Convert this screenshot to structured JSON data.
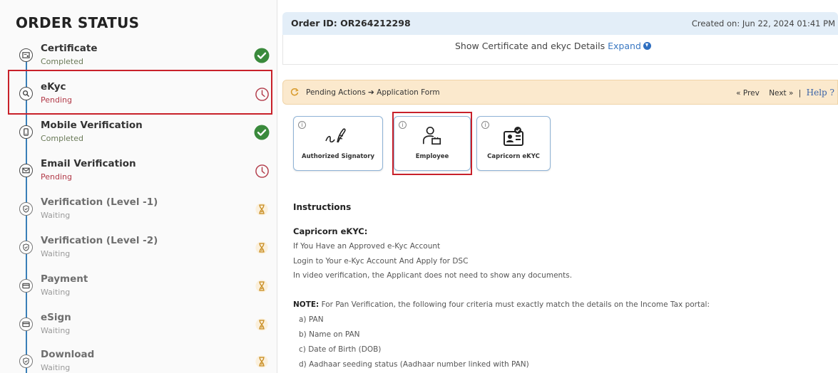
{
  "sidebar": {
    "title": "ORDER STATUS",
    "steps": [
      {
        "label": "Certificate",
        "status": "Completed",
        "state": "completed",
        "icon": "certificate-icon"
      },
      {
        "label": "eKyc",
        "status": "Pending",
        "state": "pending",
        "icon": "search-icon"
      },
      {
        "label": "Mobile Verification",
        "status": "Completed",
        "state": "completed",
        "icon": "mobile-icon"
      },
      {
        "label": "Email Verification",
        "status": "Pending",
        "state": "pending",
        "icon": "envelope-icon"
      },
      {
        "label": "Verification (Level -1)",
        "status": "Waiting",
        "state": "waiting",
        "icon": "shield-icon"
      },
      {
        "label": "Verification (Level -2)",
        "status": "Waiting",
        "state": "waiting",
        "icon": "shield-icon"
      },
      {
        "label": "Payment",
        "status": "Waiting",
        "state": "waiting",
        "icon": "card-icon"
      },
      {
        "label": "eSign",
        "status": "Waiting",
        "state": "waiting",
        "icon": "card-icon"
      },
      {
        "label": "Download",
        "status": "Waiting",
        "state": "waiting",
        "icon": "shield-icon"
      }
    ]
  },
  "header": {
    "order_id": "Order ID: OR264212298",
    "created_on": "Created on: Jun 22, 2024 01:41 PM"
  },
  "certificate_details": {
    "text": "Show Certificate and ekyc Details",
    "expand_label": "Expand"
  },
  "pending_bar": {
    "breadcrumb": "Pending Actions ➔ Application Form",
    "prev_label": "« Prev",
    "next_label": "Next »",
    "help_label": "Help ?"
  },
  "cards": [
    {
      "label": "Authorized Signatory",
      "icon": "signature-icon"
    },
    {
      "label": "Employee",
      "icon": "employee-icon"
    },
    {
      "label": "Capricorn eKYC",
      "icon": "id-card-icon"
    }
  ],
  "instructions": {
    "heading": "Instructions",
    "subheading": "Capricorn eKYC:",
    "lines": [
      "If You Have an Approved e-Kyc Account",
      "Login to Your e-Kyc Account And Apply for DSC",
      "In video verification, the Applicant does not need to show any documents."
    ],
    "note_label": "NOTE:",
    "note_text": " For Pan Verification, the following four criteria must exactly match the details on the Income Tax portal:",
    "criteria": [
      "a) PAN",
      "b) Name on PAN",
      "c) Date of Birth (DOB)",
      "d) Aadhaar seeding status (Aadhaar number linked with PAN)"
    ]
  },
  "colors": {
    "completed": "#3a8a3c",
    "pending": "#b23a48",
    "waiting": "#d8a74a",
    "highlight": "#c8212a",
    "timeline": "#3a7fb8"
  }
}
